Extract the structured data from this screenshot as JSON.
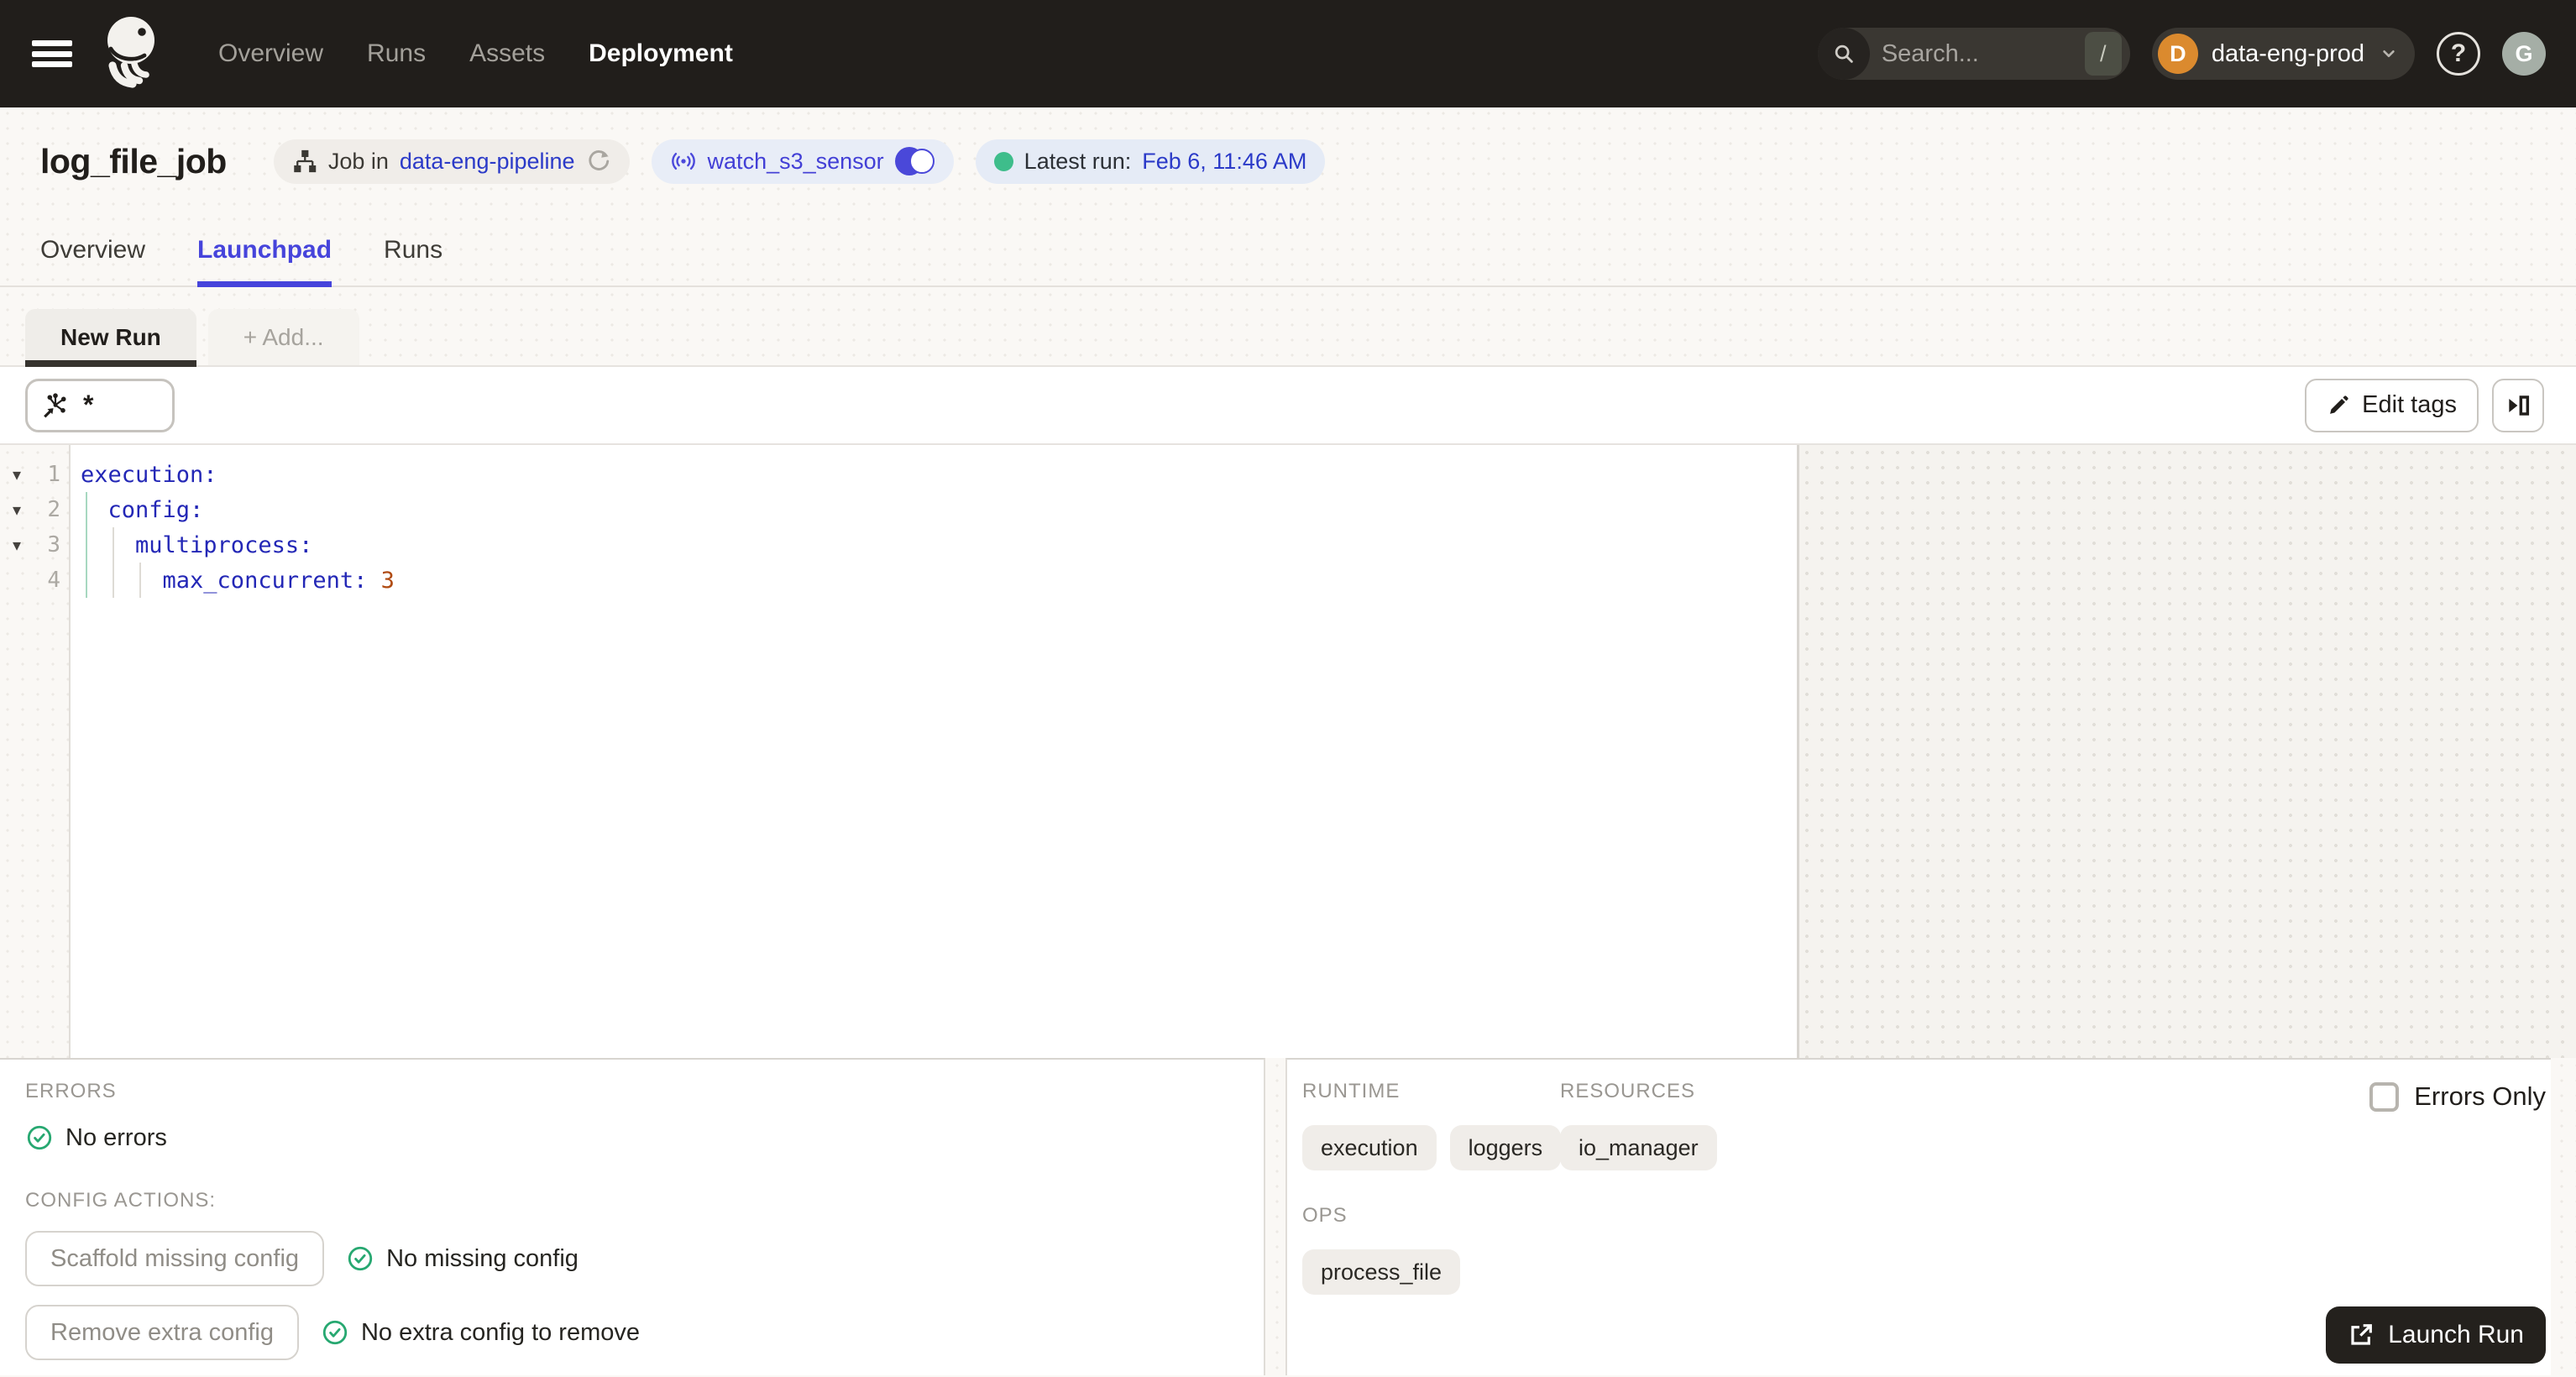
{
  "nav": {
    "items": [
      {
        "label": "Overview"
      },
      {
        "label": "Runs"
      },
      {
        "label": "Assets"
      },
      {
        "label": "Deployment"
      }
    ],
    "search_placeholder": "Search...",
    "search_shortcut": "/",
    "deployment_name": "data-eng-prod",
    "deployment_initial": "D",
    "avatar_initial": "G",
    "help_glyph": "?"
  },
  "header": {
    "title": "log_file_job",
    "job_badge_prefix": "Job in",
    "job_badge_link": "data-eng-pipeline",
    "sensor_name": "watch_s3_sensor",
    "latest_run_label": "Latest run:",
    "latest_run_value": "Feb 6, 11:46 AM"
  },
  "tabs": [
    {
      "label": "Overview"
    },
    {
      "label": "Launchpad"
    },
    {
      "label": "Runs"
    }
  ],
  "launchpad": {
    "run_tab_label": "New Run",
    "add_tab_label": "+ Add...",
    "op_selector_value": "*",
    "edit_tags_label": "Edit tags",
    "editor": {
      "lines": [
        {
          "num": "1",
          "text": "execution:",
          "value": ""
        },
        {
          "num": "2",
          "text": "  config:",
          "value": ""
        },
        {
          "num": "3",
          "text": "    multiprocess:",
          "value": ""
        },
        {
          "num": "4",
          "text": "      max_concurrent: ",
          "value": "3"
        }
      ]
    },
    "footer": {
      "errors_label": "ERRORS",
      "no_errors_text": "No errors",
      "config_actions_label": "CONFIG ACTIONS:",
      "scaffold_button": "Scaffold missing config",
      "scaffold_status": "No missing config",
      "remove_button": "Remove extra config",
      "remove_status": "No extra config to remove"
    },
    "sidebar": {
      "runtime_label": "RUNTIME",
      "runtime_tags": [
        {
          "label": "execution"
        },
        {
          "label": "loggers"
        }
      ],
      "resources_label": "RESOURCES",
      "resources_tags": [
        {
          "label": "io_manager"
        }
      ],
      "ops_label": "OPS",
      "ops_tags": [
        {
          "label": "process_file"
        }
      ],
      "errors_only_label": "Errors Only",
      "launch_button_label": "Launch Run"
    }
  },
  "colors": {
    "accent_blurple": "#4644DB",
    "link_blue": "#2B3AC8",
    "success_green": "#27A871",
    "orange_badge": "#DB8A2E",
    "nav_background": "#211E1B",
    "editor_key_blue": "#2327B6",
    "editor_value_orange": "#B04B12"
  }
}
